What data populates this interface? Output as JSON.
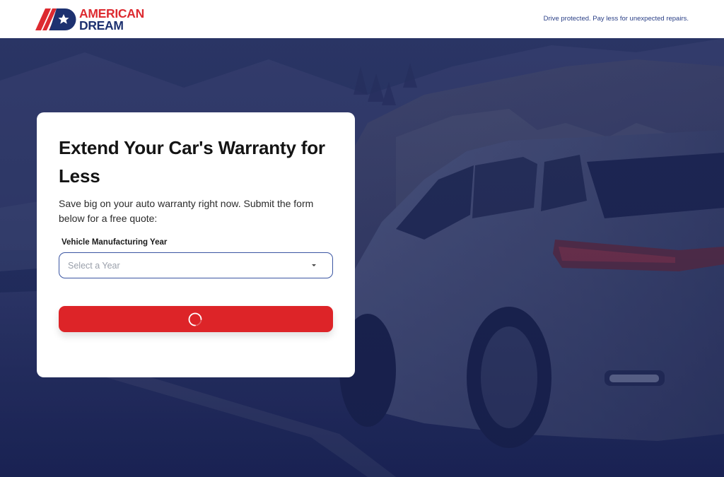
{
  "header": {
    "brand_line1": "AMERICAN",
    "brand_line2": "DREAM",
    "tagline": "Drive protected. Pay less for unexpected repairs."
  },
  "form": {
    "title": "Extend Your Car's Warranty for Less",
    "subtitle": "Save big on your auto warranty right now. Submit the form below for a free quote:",
    "year_label": "Vehicle Manufacturing Year",
    "year_placeholder": "Select a Year",
    "submit_state": "loading"
  },
  "colors": {
    "brand_red": "#dd2a30",
    "brand_navy": "#1d3170",
    "button_red": "#dd2428",
    "select_border": "#3a55a2"
  },
  "icons": {
    "logo": "american-dream-logo-icon",
    "caret": "chevron-down-icon",
    "spinner": "loading-spinner-icon"
  }
}
